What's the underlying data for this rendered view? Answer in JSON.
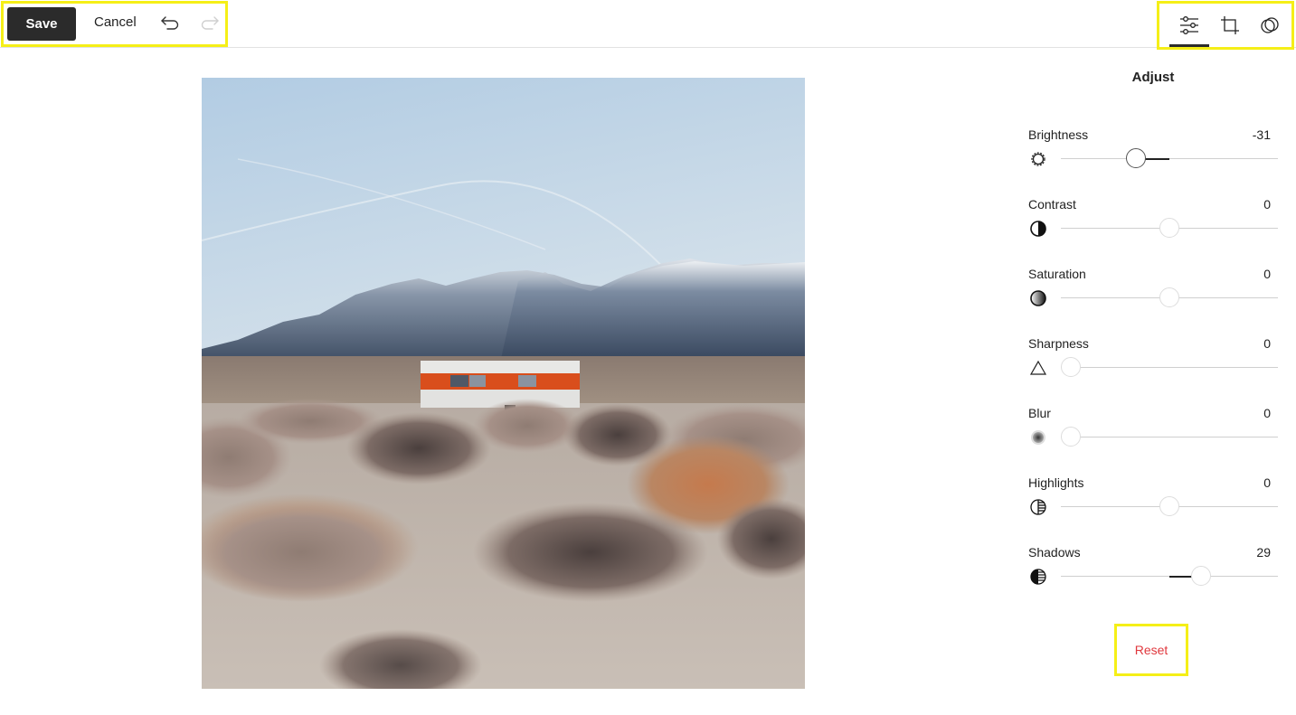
{
  "toolbar": {
    "save_label": "Save",
    "cancel_label": "Cancel",
    "undo_icon": "undo-arrow-icon",
    "redo_icon": "redo-arrow-icon",
    "redo_enabled": false
  },
  "tools": [
    {
      "name": "adjust",
      "icon": "sliders-icon",
      "active": true
    },
    {
      "name": "crop",
      "icon": "crop-icon",
      "active": false
    },
    {
      "name": "filters",
      "icon": "overlapping-circles-icon",
      "active": false
    }
  ],
  "image": {
    "description": "Desert landscape with snow-capped mountains and an orange-striped white trailer among sagebrush"
  },
  "panel": {
    "title": "Adjust",
    "adjustments": [
      {
        "label": "Brightness",
        "value": "-31",
        "icon": "brightness-icon",
        "numeric": -31,
        "min": -100,
        "max": 100
      },
      {
        "label": "Contrast",
        "value": "0",
        "icon": "contrast-icon",
        "numeric": 0,
        "min": -100,
        "max": 100
      },
      {
        "label": "Saturation",
        "value": "0",
        "icon": "saturation-icon",
        "numeric": 0,
        "min": -100,
        "max": 100
      },
      {
        "label": "Sharpness",
        "value": "0",
        "icon": "sharpness-icon",
        "numeric": 0,
        "min": 0,
        "max": 100
      },
      {
        "label": "Blur",
        "value": "0",
        "icon": "blur-icon",
        "numeric": 0,
        "min": 0,
        "max": 100
      },
      {
        "label": "Highlights",
        "value": "0",
        "icon": "highlights-icon",
        "numeric": 0,
        "min": -100,
        "max": 100
      },
      {
        "label": "Shadows",
        "value": "29",
        "icon": "shadows-icon",
        "numeric": 29,
        "min": -100,
        "max": 100
      }
    ],
    "reset_label": "Reset",
    "reset_color": "#e0383e"
  }
}
